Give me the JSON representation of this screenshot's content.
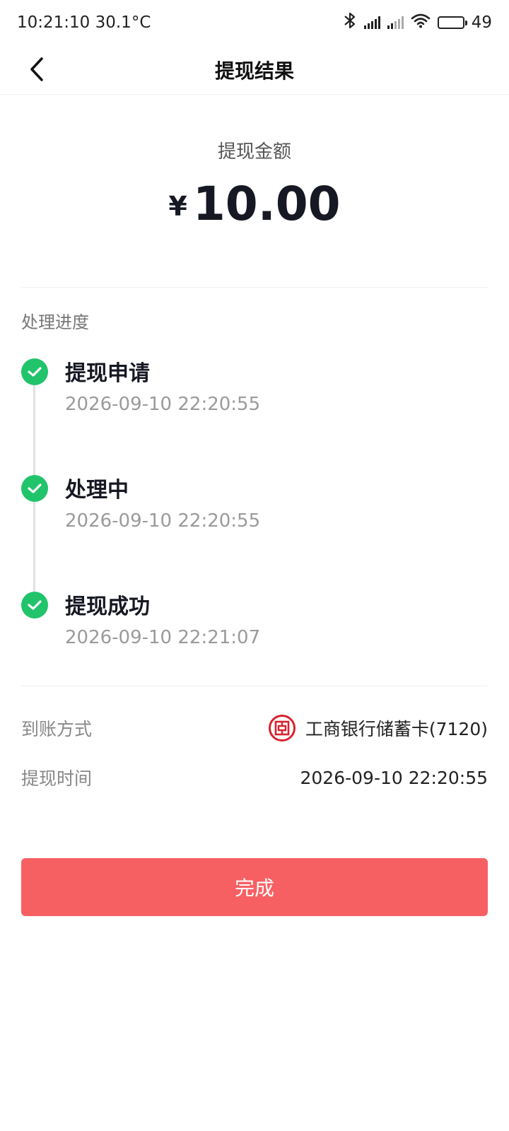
{
  "status_bar": {
    "time_temp": "10:21:10 30.1°C",
    "battery": "49",
    "icons": [
      "bluetooth-icon",
      "signal-icon",
      "signal-icon",
      "wifi-icon",
      "battery-icon"
    ]
  },
  "nav": {
    "back_icon": "chevron-left-icon",
    "title": "提现结果"
  },
  "amount": {
    "label": "提现金额",
    "currency": "¥",
    "value": "10.00"
  },
  "progress": {
    "label": "处理进度",
    "steps": [
      {
        "title": "提现申请",
        "time": "2026-09-10 22:20:55",
        "status": "done"
      },
      {
        "title": "处理中",
        "time": "2026-09-10 22:20:55",
        "status": "done"
      },
      {
        "title": "提现成功",
        "time": "2026-09-10 22:21:07",
        "status": "done"
      }
    ]
  },
  "info": {
    "method_key": "到账方式",
    "method_value": "工商银行储蓄卡(7120)",
    "method_icon": "icbc-logo-icon",
    "time_key": "提现时间",
    "time_value": "2026-09-10 22:20:55"
  },
  "button": {
    "done_label": "完成"
  },
  "colors": {
    "accent": "#f76063",
    "success": "#21c36b",
    "bank": "#d6232f"
  }
}
